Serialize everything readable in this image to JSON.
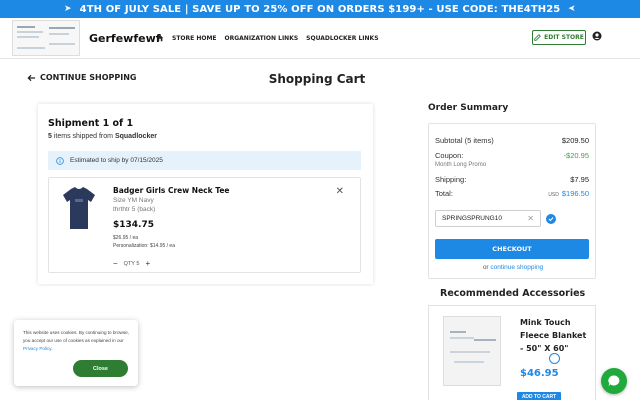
{
  "promo": {
    "text": "4TH OF JULY SALE | SAVE UP TO 25% OFF ON ORDERS $199+ - USE CODE: THE4TH25"
  },
  "header": {
    "brand": "Gerfewfewf",
    "nav": [
      "STORE HOME",
      "ORGANIZATION LINKS",
      "SQUADLOCKER LINKS"
    ],
    "edit_store": "EDIT STORE"
  },
  "page": {
    "continue_label": "CONTINUE SHOPPING",
    "title": "Shopping Cart"
  },
  "shipment": {
    "title": "Shipment 1 of 1",
    "count": "5",
    "sub_text": " items shipped from ",
    "source": "Squadlocker",
    "estimate": "Estimated to ship by 07/15/2025",
    "item": {
      "name": "Badger Girls Crew Neck Tee",
      "size": "Size YM Navy",
      "option": "thrthtr 5 (back)",
      "price": "$134.75",
      "unit_price": "$26.95 / ea",
      "personalization": "Personalization: $14.95 / ea",
      "qty_label": "QTY 5"
    }
  },
  "summary": {
    "title": "Order Summary",
    "subtotal_label": "Subtotal (5 items)",
    "subtotal_value": "$209.50",
    "coupon_label": "Coupon:",
    "coupon_value": "-$20.95",
    "coupon_name": "Month Long Promo",
    "shipping_label": "Shipping:",
    "shipping_value": "$7.95",
    "total_label": "Total:",
    "total_currency": "USD",
    "total_value": "$196.50",
    "code_value": "SPRINGSPRUNG10",
    "checkout_label": "CHECKOUT",
    "or_text": "or ",
    "continue_link": "continue shopping"
  },
  "recommended": {
    "title": "Recommended Accessories",
    "name": "Mink Touch Fleece Blanket - 50\" X 60\"",
    "price": "$46.95",
    "add_label": "ADD TO CART"
  },
  "cookie": {
    "text": "This website uses cookies. By continuing to browse, you accept our use of cookies as explained in our ",
    "link": "Privacy Policy",
    "end": ".",
    "close_label": "Close"
  },
  "colors": {
    "accent": "#1e88e5",
    "green": "#2e7d32",
    "discount": "#43a047",
    "chat": "#1faa3b"
  },
  "icons": [
    "home-icon",
    "pencil-icon",
    "user-icon",
    "arrow-left-icon",
    "info-icon",
    "close-icon",
    "check-icon",
    "chat-icon"
  ]
}
